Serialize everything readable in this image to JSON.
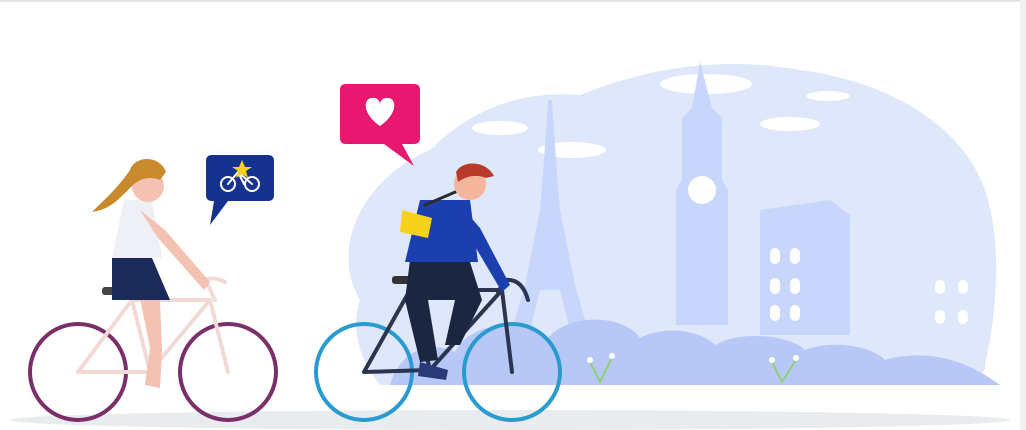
{
  "scene": {
    "colors": {
      "background": "#ffffff",
      "skyline": "#dfe7fb",
      "landmark": "#c9d6fb",
      "bushes": "#b8c8f6",
      "road_shadow": "#e9ecef",
      "heart_bubble": "#e8176f",
      "cycle_bubble": "#16328f",
      "star": "#f6d21a",
      "woman_hair": "#c98a2e",
      "woman_skin": "#f3c2b2",
      "woman_top": "#eef0f5",
      "woman_skirt": "#1c2a5a",
      "woman_bike_frame": "#f1d9d6",
      "woman_bike_rims": "#7b2f6a",
      "man_hair": "#b83a2a",
      "man_skin": "#f4b59d",
      "man_jacket": "#1c3fb0",
      "man_pants": "#1b2740",
      "man_bag": "#f6d21a",
      "man_bike_frame": "#2b3550",
      "man_bike_rims": "#2a9bd0"
    },
    "icons": {
      "heart_bubble": "heart-speech-bubble-icon",
      "cycle_bubble": "bicycle-star-speech-bubble-icon"
    }
  }
}
